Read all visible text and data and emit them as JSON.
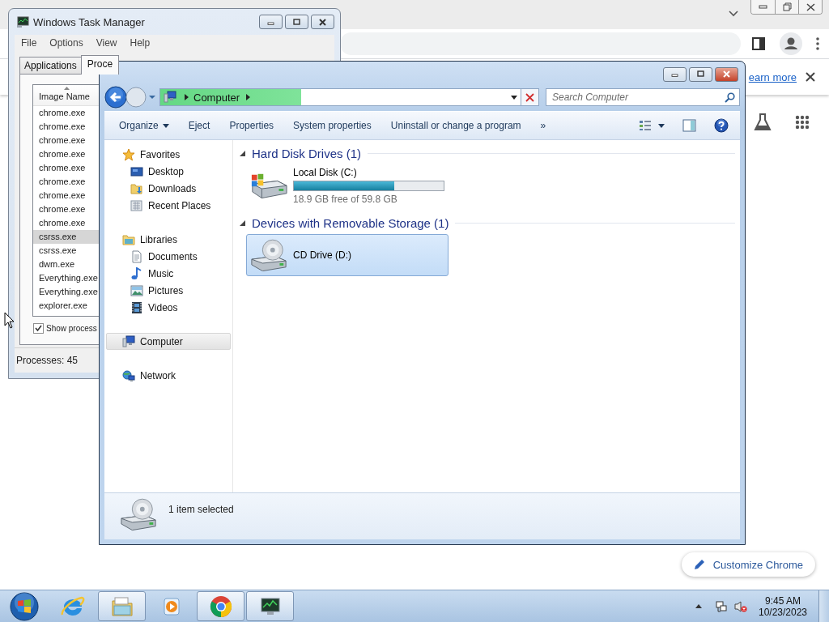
{
  "chrome": {
    "infobar_link": "earn more",
    "customize_button": "Customize Chrome"
  },
  "task_manager": {
    "title": "Windows Task Manager",
    "menu": [
      "File",
      "Options",
      "View",
      "Help"
    ],
    "tabs": [
      {
        "label": "Applications",
        "selected": false
      },
      {
        "label": "Proce",
        "selected": true
      }
    ],
    "column": "Image Name",
    "processes": [
      {
        "name": "chrome.exe",
        "selected": false
      },
      {
        "name": "chrome.exe",
        "selected": false
      },
      {
        "name": "chrome.exe",
        "selected": false
      },
      {
        "name": "chrome.exe",
        "selected": false
      },
      {
        "name": "chrome.exe",
        "selected": false
      },
      {
        "name": "chrome.exe",
        "selected": false
      },
      {
        "name": "chrome.exe",
        "selected": false
      },
      {
        "name": "chrome.exe",
        "selected": false
      },
      {
        "name": "chrome.exe",
        "selected": false
      },
      {
        "name": "csrss.exe",
        "selected": true
      },
      {
        "name": "csrss.exe",
        "selected": false
      },
      {
        "name": "dwm.exe",
        "selected": false
      },
      {
        "name": "Everything.exe",
        "selected": false
      },
      {
        "name": "Everything.exe",
        "selected": false
      },
      {
        "name": "explorer.exe",
        "selected": false
      }
    ],
    "show_all": {
      "label": "Show process",
      "checked": true
    },
    "status": "Processes: 45"
  },
  "explorer": {
    "address": {
      "crumb": "Computer",
      "level": 0.39
    },
    "search": {
      "placeholder": "Search Computer"
    },
    "toolbar": [
      {
        "label": "Organize",
        "kind": "menu"
      },
      {
        "label": "Eject",
        "kind": "command"
      },
      {
        "label": "Properties",
        "kind": "command"
      },
      {
        "label": "System properties",
        "kind": "command"
      },
      {
        "label": "Uninstall or change a program",
        "kind": "command"
      },
      {
        "label": "»",
        "kind": "overflow"
      }
    ],
    "nav": [
      {
        "label": "Favorites",
        "kind": "favorites",
        "selected": false,
        "children": [
          {
            "label": "Desktop",
            "kind": "desktop",
            "selected": false
          },
          {
            "label": "Downloads",
            "kind": "downloads",
            "selected": false
          },
          {
            "label": "Recent Places",
            "kind": "recent",
            "selected": false
          }
        ]
      },
      {
        "label": "Libraries",
        "kind": "libraries",
        "selected": false,
        "children": [
          {
            "label": "Documents",
            "kind": "documents",
            "selected": false
          },
          {
            "label": "Music",
            "kind": "music",
            "selected": false
          },
          {
            "label": "Pictures",
            "kind": "pictures",
            "selected": false
          },
          {
            "label": "Videos",
            "kind": "videos",
            "selected": false
          }
        ]
      },
      {
        "label": "Computer",
        "kind": "computer",
        "selected": true
      },
      {
        "label": "Network",
        "kind": "network",
        "selected": false
      }
    ],
    "groups": [
      {
        "title": "Hard Disk Drives (1)",
        "expanded": true,
        "items": [
          {
            "name": "Local Disk (C:)",
            "kind": "disk",
            "level": 0.67,
            "space": "18.9 GB free of 59.8 GB",
            "selected": false
          }
        ]
      },
      {
        "title": "Devices with Removable Storage (1)",
        "expanded": true,
        "items": [
          {
            "name": "CD Drive (D:)",
            "kind": "cd",
            "selected": true
          }
        ]
      }
    ],
    "details": "1 item selected"
  },
  "taskbar": {
    "apps": [
      {
        "kind": "ie",
        "running": false
      },
      {
        "kind": "explorer",
        "running": true
      },
      {
        "kind": "media",
        "running": false
      },
      {
        "kind": "chrome",
        "running": true
      },
      {
        "kind": "taskmgr",
        "running": true
      }
    ],
    "time": "9:45 AM",
    "date": "10/23/2023"
  }
}
